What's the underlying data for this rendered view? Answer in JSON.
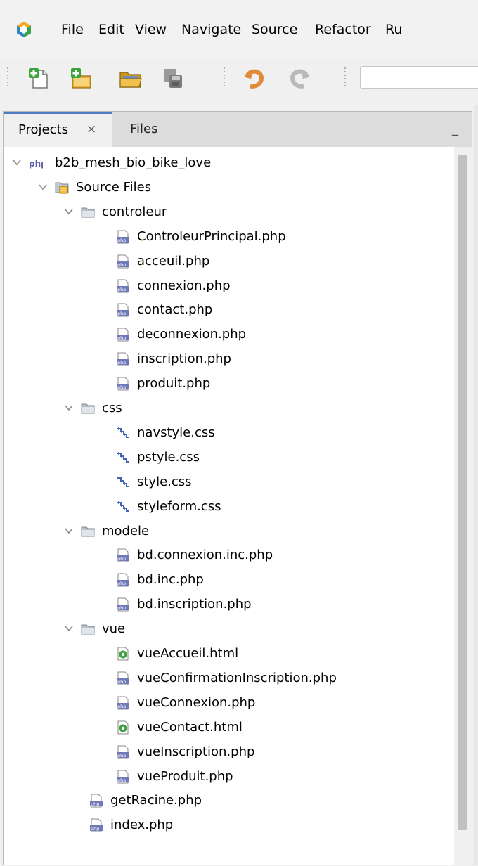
{
  "menu": {
    "items": [
      "File",
      "Edit",
      "View",
      "Navigate",
      "Source",
      "Refactor",
      "Ru"
    ]
  },
  "toolbar": {
    "buttons": [
      "new-file-icon",
      "new-project-icon",
      "open-project-icon",
      "save-all-icon",
      "undo-icon",
      "redo-icon"
    ]
  },
  "tabs": {
    "projects_label": "Projects",
    "projects_close": "×",
    "files_label": "Files",
    "minimize": "_"
  },
  "tree": [
    {
      "label": "b2b_mesh_bio_bike_love",
      "level": 0,
      "icon": "php-project-icon",
      "expanded": true
    },
    {
      "label": "Source Files",
      "level": 1,
      "icon": "source-files-icon",
      "expanded": true
    },
    {
      "label": "controleur",
      "level": 2,
      "icon": "folder-icon",
      "expanded": true
    },
    {
      "label": "ControleurPrincipal.php",
      "level": 3,
      "icon": "php-file-icon"
    },
    {
      "label": "acceuil.php",
      "level": 3,
      "icon": "php-file-icon"
    },
    {
      "label": "connexion.php",
      "level": 3,
      "icon": "php-file-icon"
    },
    {
      "label": "contact.php",
      "level": 3,
      "icon": "php-file-icon"
    },
    {
      "label": "deconnexion.php",
      "level": 3,
      "icon": "php-file-icon"
    },
    {
      "label": "inscription.php",
      "level": 3,
      "icon": "php-file-icon"
    },
    {
      "label": "produit.php",
      "level": 3,
      "icon": "php-file-icon"
    },
    {
      "label": "css",
      "level": 2,
      "icon": "folder-icon",
      "expanded": true
    },
    {
      "label": "navstyle.css",
      "level": 3,
      "icon": "css-file-icon"
    },
    {
      "label": "pstyle.css",
      "level": 3,
      "icon": "css-file-icon"
    },
    {
      "label": "style.css",
      "level": 3,
      "icon": "css-file-icon"
    },
    {
      "label": "styleform.css",
      "level": 3,
      "icon": "css-file-icon"
    },
    {
      "label": "modele",
      "level": 2,
      "icon": "folder-icon",
      "expanded": true
    },
    {
      "label": "bd.connexion.inc.php",
      "level": 3,
      "icon": "php-file-icon"
    },
    {
      "label": "bd.inc.php",
      "level": 3,
      "icon": "php-file-icon"
    },
    {
      "label": "bd.inscription.php",
      "level": 3,
      "icon": "php-file-icon"
    },
    {
      "label": "vue",
      "level": 2,
      "icon": "folder-icon",
      "expanded": true
    },
    {
      "label": "vueAccueil.html",
      "level": 3,
      "icon": "html-file-icon"
    },
    {
      "label": "vueConfirmationInscription.php",
      "level": 3,
      "icon": "php-file-icon"
    },
    {
      "label": "vueConnexion.php",
      "level": 3,
      "icon": "php-file-icon"
    },
    {
      "label": "vueContact.html",
      "level": 3,
      "icon": "html-file-icon"
    },
    {
      "label": "vueInscription.php",
      "level": 3,
      "icon": "php-file-icon"
    },
    {
      "label": "vueProduit.php",
      "level": 3,
      "icon": "php-file-icon"
    },
    {
      "label": "getRacine.php",
      "level": 2,
      "icon": "php-file-icon"
    },
    {
      "label": "index.php",
      "level": 2,
      "icon": "php-file-icon"
    }
  ]
}
